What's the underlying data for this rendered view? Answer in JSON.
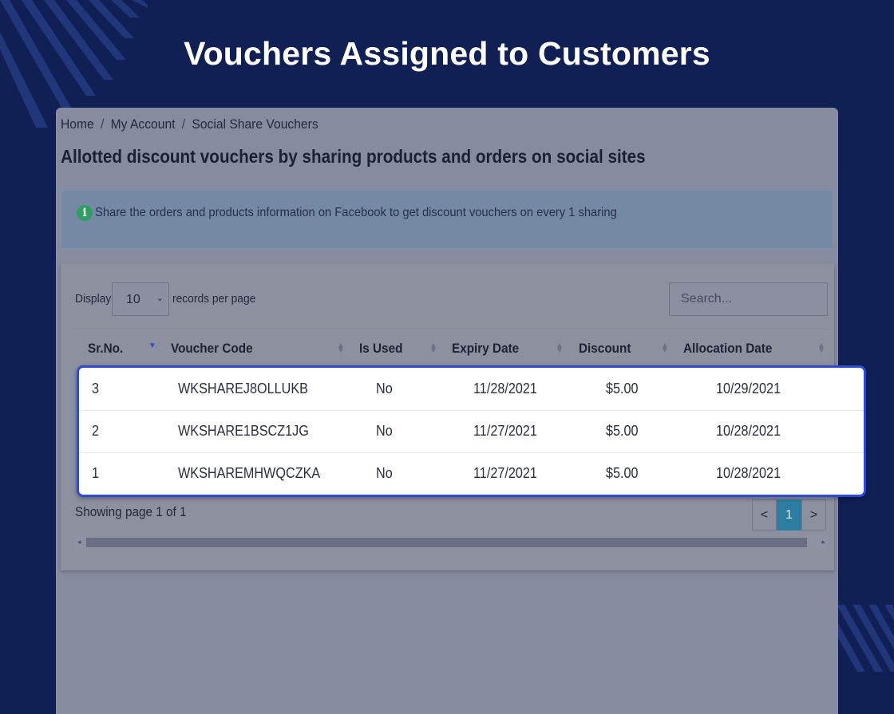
{
  "hero": {
    "title": "Vouchers Assigned to Customers"
  },
  "breadcrumb": [
    {
      "label": "Home"
    },
    {
      "label": "My Account"
    },
    {
      "label": "Social Share Vouchers"
    }
  ],
  "page": {
    "heading": "Allotted discount vouchers by sharing products and orders on social sites"
  },
  "info": {
    "text": "Share the orders and products information on Facebook to get discount vouchers on every 1 sharing"
  },
  "controls": {
    "display_label": "Display",
    "page_size": "10",
    "records_label": "records per page",
    "search_placeholder": "Search..."
  },
  "table": {
    "columns": [
      "Sr.No.",
      "Voucher Code",
      "Is Used",
      "Expiry Date",
      "Discount",
      "Allocation Date"
    ],
    "rows": [
      [
        "3",
        "WKSHAREJ8OLLUKB",
        "No",
        "11/28/2021",
        "$5.00",
        "10/29/2021"
      ],
      [
        "2",
        "WKSHARE1BSCZ1JG",
        "No",
        "11/27/2021",
        "$5.00",
        "10/28/2021"
      ],
      [
        "1",
        "WKSHAREMHWQCZKA",
        "No",
        "11/27/2021",
        "$5.00",
        "10/28/2021"
      ]
    ]
  },
  "footer": {
    "showing": "Showing page 1 of 1",
    "prev": "<",
    "current": "1",
    "next": ">"
  },
  "colors": {
    "background": "#102055",
    "highlight_border": "#2e4bd6",
    "active_page": "#2c7ea0",
    "info_icon": "#2f9e63"
  }
}
